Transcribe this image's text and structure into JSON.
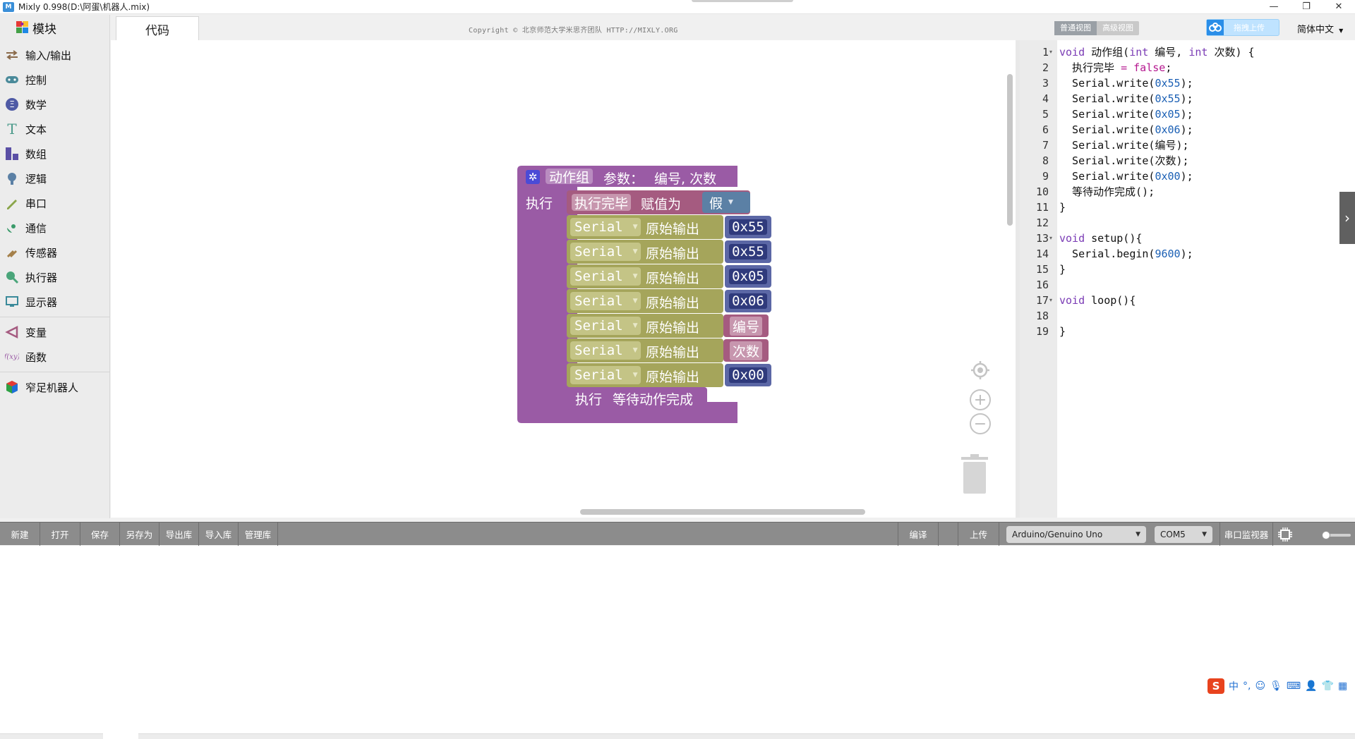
{
  "window": {
    "title": "Mixly 0.998(D:\\阿蛋\\机器人.mix)",
    "controls": [
      "—",
      "❐",
      "✕"
    ]
  },
  "toolbox": {
    "header": "模块",
    "items": [
      {
        "label": "输入/输出",
        "icon": "input-output-icon"
      },
      {
        "label": "控制",
        "icon": "gamepad-icon"
      },
      {
        "label": "数学",
        "icon": "math-icon"
      },
      {
        "label": "文本",
        "icon": "text-icon"
      },
      {
        "label": "数组",
        "icon": "array-icon"
      },
      {
        "label": "逻辑",
        "icon": "logic-bulb-icon"
      },
      {
        "label": "串口",
        "icon": "serial-pen-icon"
      },
      {
        "label": "通信",
        "icon": "satellite-icon"
      },
      {
        "label": "传感器",
        "icon": "sensor-icon"
      },
      {
        "label": "执行器",
        "icon": "actuator-icon"
      },
      {
        "label": "显示器",
        "icon": "monitor-icon"
      },
      {
        "label": "变量",
        "icon": "variable-icon"
      },
      {
        "label": "函数",
        "icon": "function-icon"
      },
      {
        "label": "窄足机器人",
        "icon": "robot-cube-icon"
      }
    ]
  },
  "tabs": {
    "code": "代码"
  },
  "copyright": "Copyright © 北京师范大学米思齐团队 HTTP://MIXLY.ORG",
  "view_toggle": {
    "normal": "普通视图",
    "advanced": "高级视图"
  },
  "upload_button": "拖拽上传",
  "language": "简体中文",
  "blocks": {
    "func_title": "动作组",
    "params_label": "参数：",
    "params": "编号, 次数",
    "exec_label": "执行",
    "assign_var": "执行完毕",
    "assign_label": "赋值为",
    "assign_value": "假",
    "serial_name": "Serial",
    "serial_action": "原始输出",
    "serial_values": [
      "0x55",
      "0x55",
      "0x05",
      "0x06",
      "编号",
      "次数",
      "0x00"
    ],
    "call_label": "执行",
    "call_name": "等待动作完成"
  },
  "code_lines": [
    "void 动作组(int 编号, int 次数) {",
    "  执行完毕 = false;",
    "  Serial.write(0x55);",
    "  Serial.write(0x55);",
    "  Serial.write(0x05);",
    "  Serial.write(0x06);",
    "  Serial.write(编号);",
    "  Serial.write(次数);",
    "  Serial.write(0x00);",
    "  等待动作完成();",
    "}",
    "",
    "void setup(){",
    "  Serial.begin(9600);",
    "}",
    "",
    "void loop(){",
    "",
    "}"
  ],
  "bottom_bar": {
    "buttons": [
      "新建",
      "打开",
      "保存",
      "另存为",
      "导出库",
      "导入库",
      "管理库"
    ],
    "compile": "编译",
    "upload": "上传",
    "board": "Arduino/Genuino Uno",
    "port": "COM5",
    "serial_monitor": "串口监视器"
  },
  "ime": {
    "logo": "S",
    "mode": "中"
  },
  "colors": {
    "function_block": "#9a5ba5",
    "logic_block": "#5b80a5",
    "serial_block": "#a5a55b",
    "hex_value": "#5b67a5",
    "var_value": "#a55b80"
  }
}
